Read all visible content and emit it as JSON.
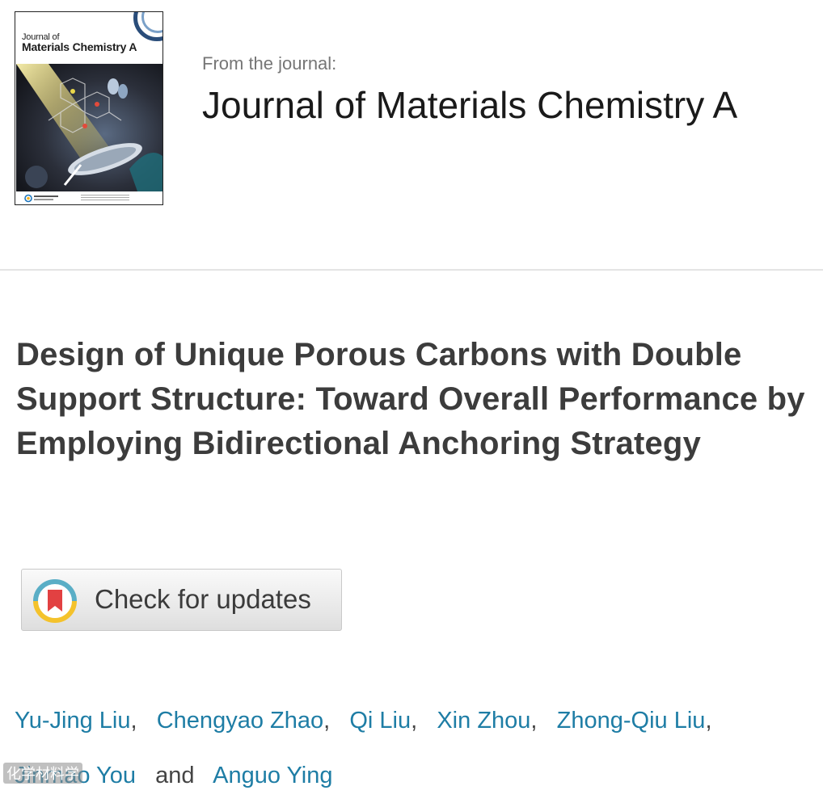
{
  "journal": {
    "from_label": "From the journal:",
    "name": "Journal of Materials Chemistry A",
    "cover": {
      "title_line1": "Journal of",
      "title_line2": "Materials Chemistry A",
      "publisher_logo": "royal-society-of-chemistry-logo"
    }
  },
  "article": {
    "title": "Design of Unique Porous Carbons with Double Support Structure: Toward Overall Performance by Employing Bidirectional Anchoring Strategy"
  },
  "check_updates": {
    "label": "Check for updates",
    "icon": "bookmark-ring-icon"
  },
  "authors": {
    "names": [
      "Yu-Jing Liu",
      "Chengyao Zhao",
      "Qi Liu",
      "Xin Zhou",
      "Zhong-Qiu Liu",
      "Jinmao You",
      "Anguo Ying"
    ],
    "separator": ",",
    "conjunction": "and",
    "link_color": "#1e7da5"
  },
  "watermark": {
    "text": "化学材料学"
  }
}
